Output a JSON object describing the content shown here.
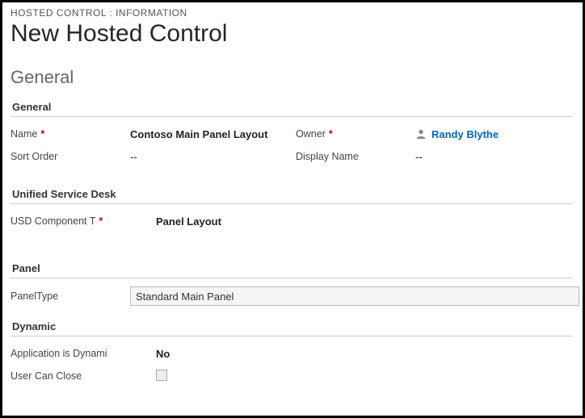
{
  "breadcrumb": "HOSTED CONTROL : INFORMATION",
  "page_title": "New Hosted Control",
  "section_general_title": "General",
  "subsections": {
    "general": "General",
    "usd": "Unified Service Desk",
    "panel": "Panel",
    "dynamic": "Dynamic"
  },
  "labels": {
    "name": "Name",
    "sort_order": "Sort Order",
    "owner": "Owner",
    "display_name": "Display Name",
    "usd_component_type": "USD Component T",
    "panel_type": "PanelType",
    "app_is_dynamic": "Application is Dynami",
    "user_can_close": "User Can Close"
  },
  "required_marker": "*",
  "values": {
    "name": "Contoso Main Panel Layout",
    "sort_order": "--",
    "owner": "Randy Blythe",
    "display_name": "--",
    "usd_component_type": "Panel Layout",
    "panel_type": "Standard Main Panel",
    "app_is_dynamic": "No"
  }
}
